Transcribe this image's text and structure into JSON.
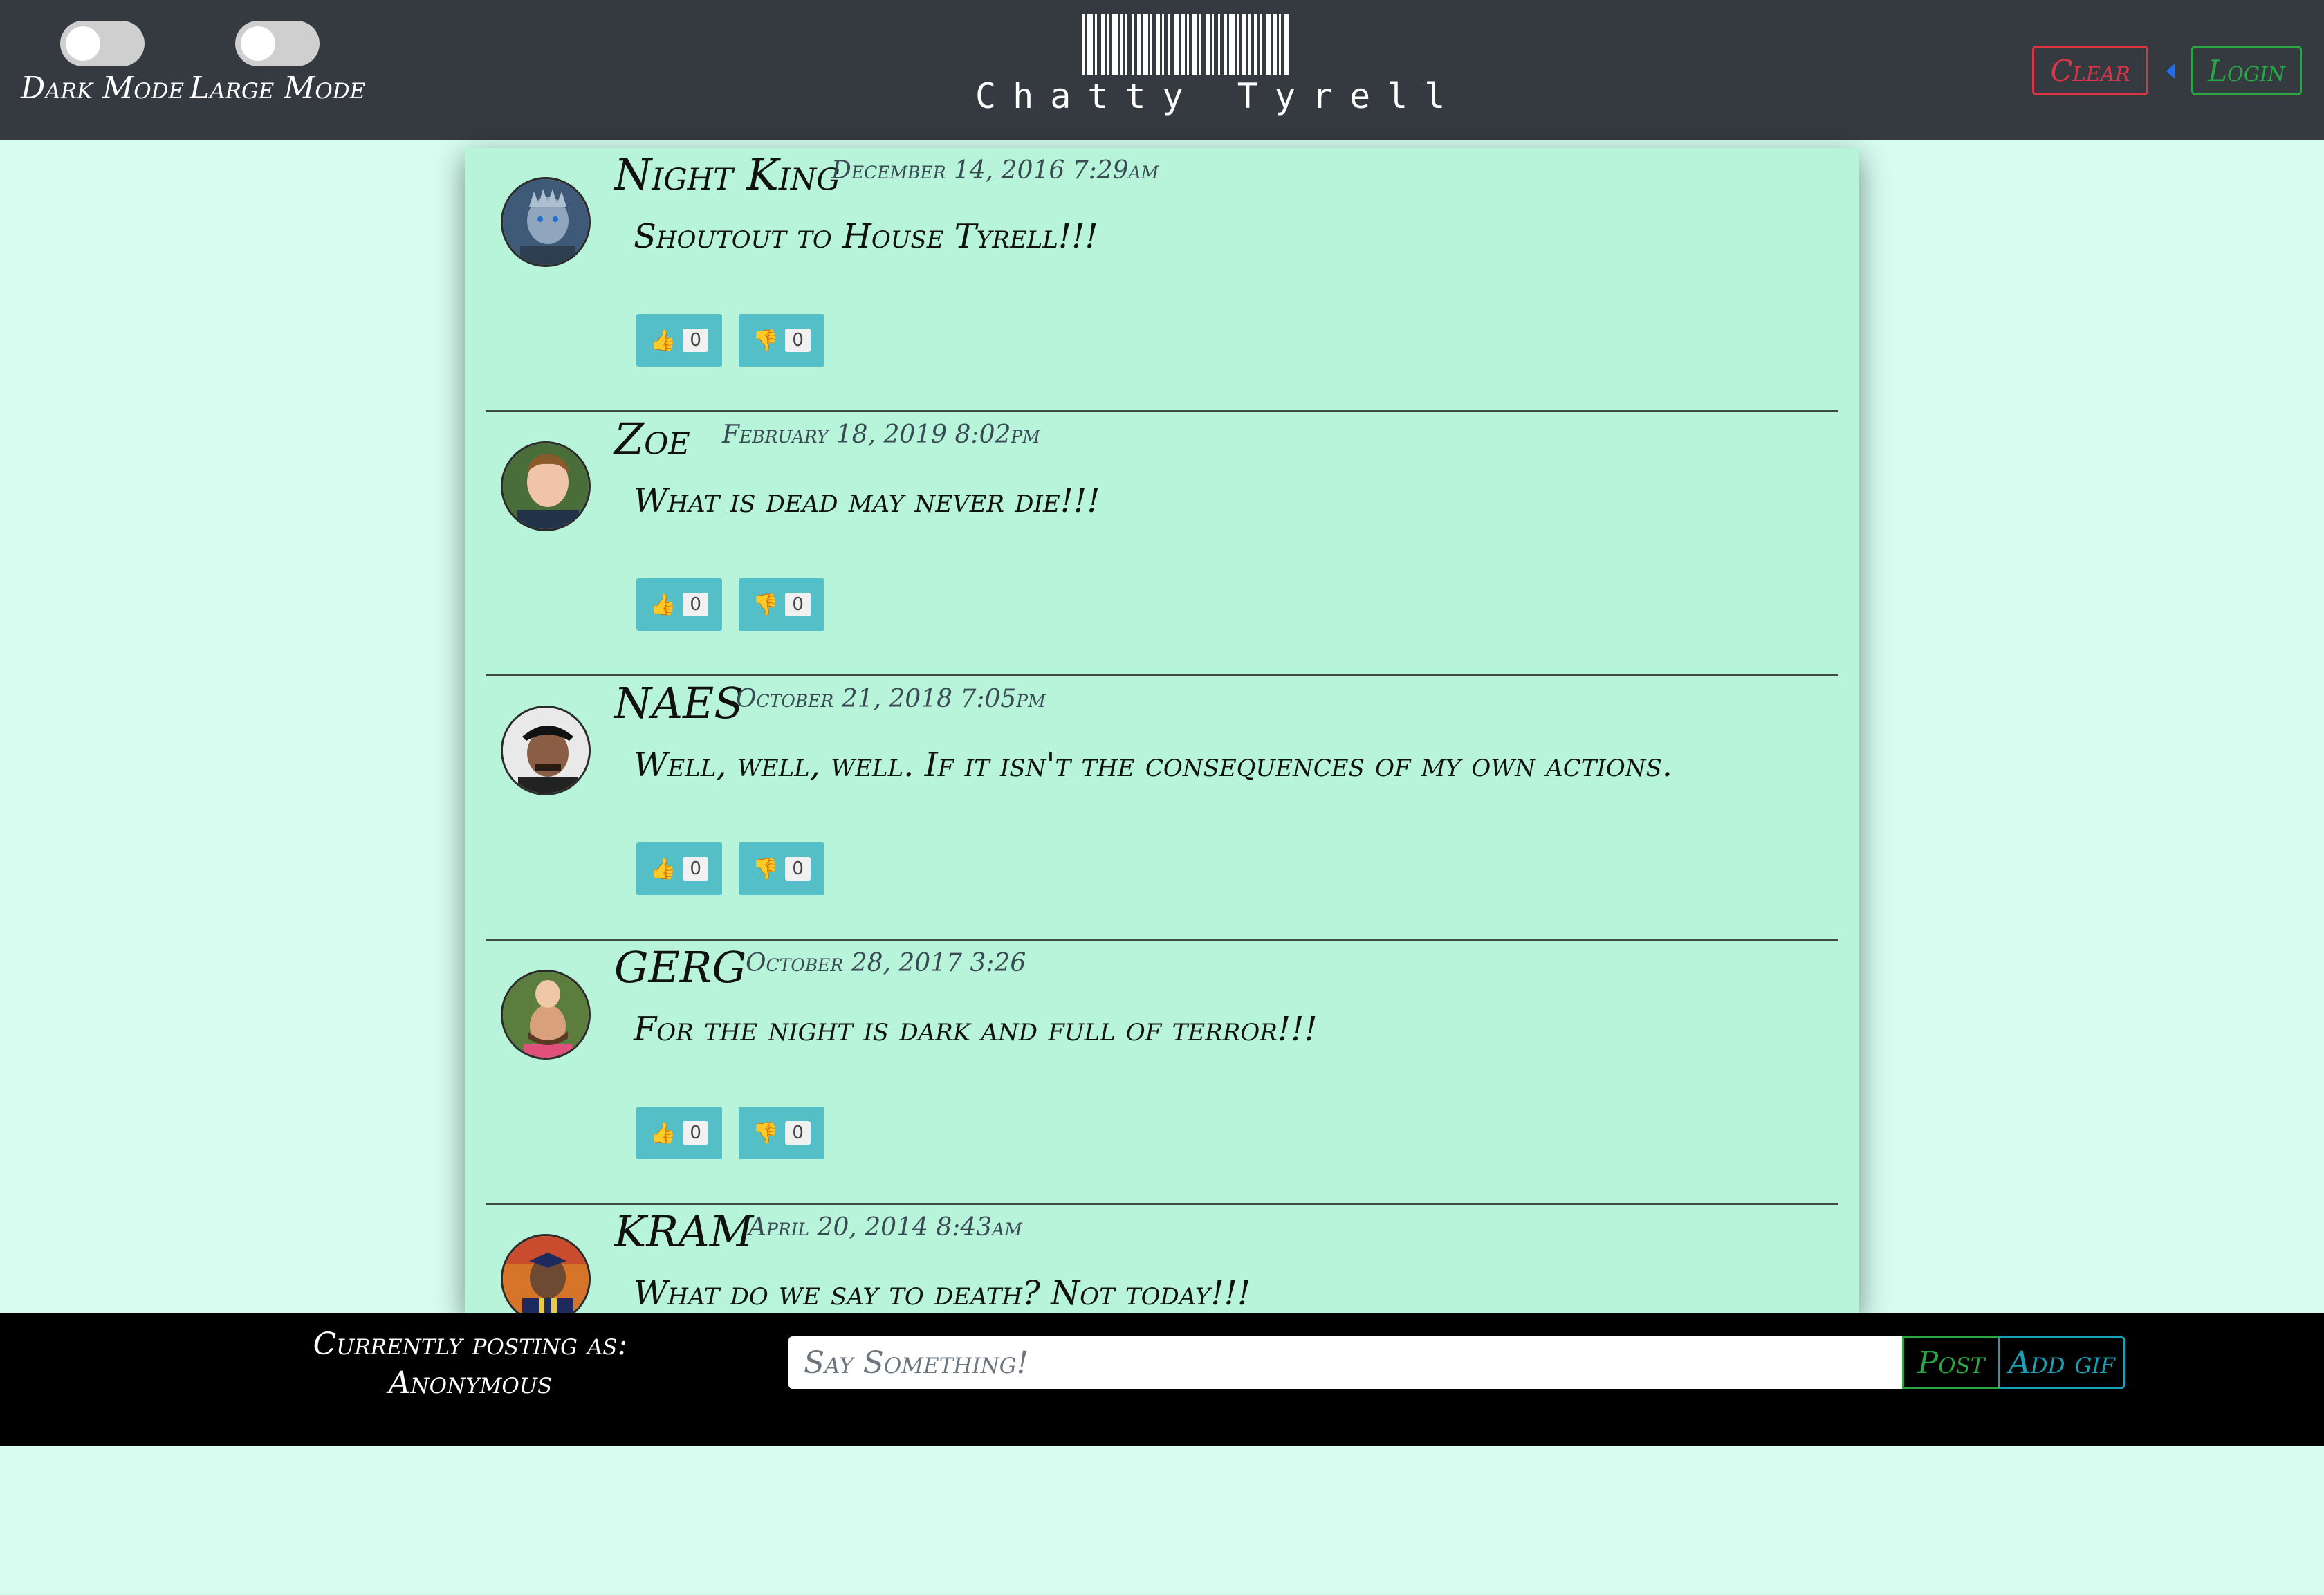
{
  "header": {
    "toggles": [
      {
        "label": "Dark Mode",
        "on": false
      },
      {
        "label": "Large Mode",
        "on": false
      }
    ],
    "brand": {
      "title": "Chatty Tyrell",
      "logo_icon": "barcode-icon"
    },
    "clear_label": "Clear",
    "login_label": "Login",
    "colors": {
      "clear": "#dc3545",
      "login": "#28a745",
      "caret": "#1e6ff0"
    }
  },
  "posts": [
    {
      "user": "Night King",
      "time": "December 14, 2016 7:29am",
      "message": "Shoutout to House Tyrell!!!",
      "likes": "0",
      "dislikes": "0"
    },
    {
      "user": "Zoe",
      "time": "February 18, 2019 8:02pm",
      "message": "What is dead may never die!!!",
      "likes": "0",
      "dislikes": "0"
    },
    {
      "user": "NAES",
      "time": "October 21, 2018 7:05pm",
      "message": "Well, well, well. If it isn't the consequences of my own actions.",
      "likes": "0",
      "dislikes": "0"
    },
    {
      "user": "GERG",
      "time": "October 28, 2017 3:26",
      "message": "For the night is dark and full of terror!!!",
      "likes": "0",
      "dislikes": "0"
    },
    {
      "user": "KRAM",
      "time": "April 20, 2014 8:43am",
      "message": "What do we say to death? Not today!!!",
      "likes": "0",
      "dislikes": "0"
    }
  ],
  "vote_icons": {
    "like": "thumbs-up-icon",
    "dislike": "thumbs-down-icon"
  },
  "footer": {
    "posting_as_label": "Currently posting as:",
    "posting_as_name": "Anonymous",
    "input_placeholder": "Say Something!",
    "post_label": "Post",
    "gif_label": "Add gif",
    "colors": {
      "post": "#28a745",
      "gif": "#17a2b8"
    }
  },
  "theme": {
    "page_bg": "#d6fdf0",
    "feed_bg": "#b7f4d9",
    "header_bg": "#343a40",
    "vote_bg": "#55bfc7"
  }
}
